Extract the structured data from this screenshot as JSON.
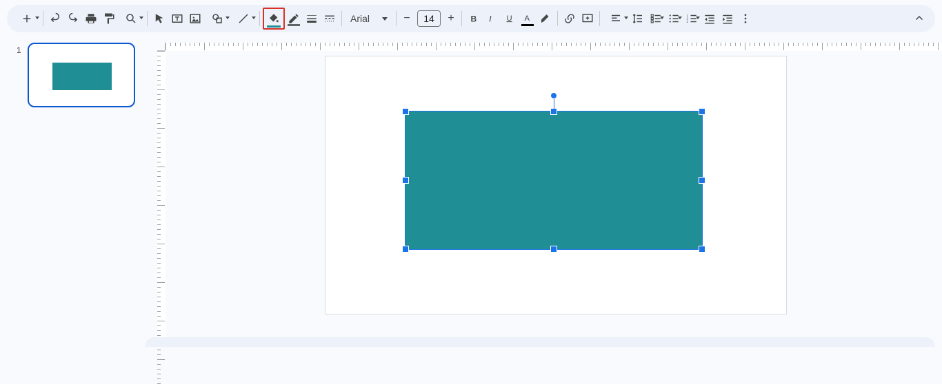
{
  "toolbar": {
    "font_name": "Arial",
    "font_size": "14",
    "fill_color": "#1f8f95",
    "border_color": "#606368",
    "text_color": "#000000",
    "highlight_color": "#ffffff"
  },
  "thumbnails": {
    "slides": [
      {
        "number": "1"
      }
    ]
  },
  "canvas": {
    "shape": {
      "type": "rectangle",
      "fill": "#1f8f95"
    }
  }
}
